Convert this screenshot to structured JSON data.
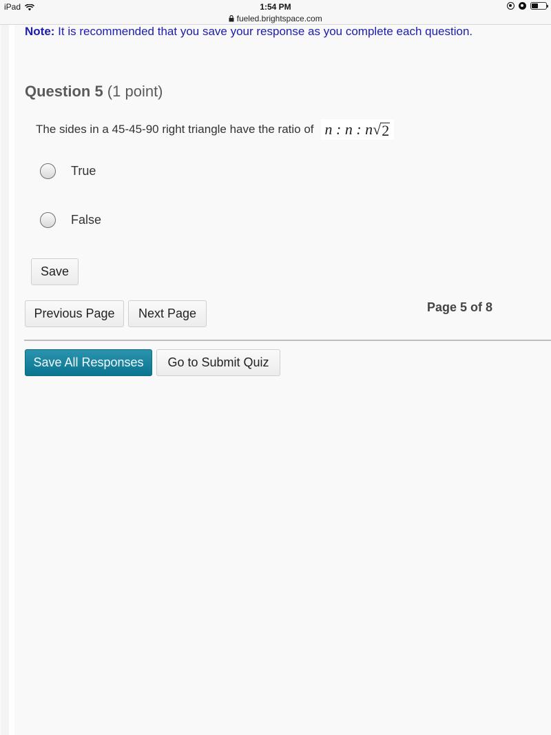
{
  "statusbar": {
    "device": "iPad",
    "time": "1:54 PM",
    "url": "fueled.brightspace.com",
    "icons": [
      "wifi-icon",
      "lock-icon",
      "orientation-lock-icon",
      "alarm-icon",
      "battery-icon"
    ]
  },
  "note": {
    "label": "Note:",
    "text": " It is recommended that you save your response as you complete each question."
  },
  "question": {
    "title": "Question 5",
    "points": " (1 point)",
    "text": "The sides in a 45-45-90 right triangle have the ratio of",
    "math": {
      "prefix": "n : n : n",
      "radicand": "2"
    },
    "options": [
      {
        "label": "True",
        "selected": false
      },
      {
        "label": "False",
        "selected": false
      }
    ],
    "save_label": "Save"
  },
  "pagination": {
    "previous_label": "Previous Page",
    "next_label": "Next Page",
    "indicator": "Page 5 of 8"
  },
  "footer": {
    "save_all_label": "Save All Responses",
    "submit_label": "Go to Submit Quiz"
  },
  "colors": {
    "note_text": "#1b1bb3",
    "primary_button": "#0a7491",
    "background": "#f9f9f9"
  }
}
